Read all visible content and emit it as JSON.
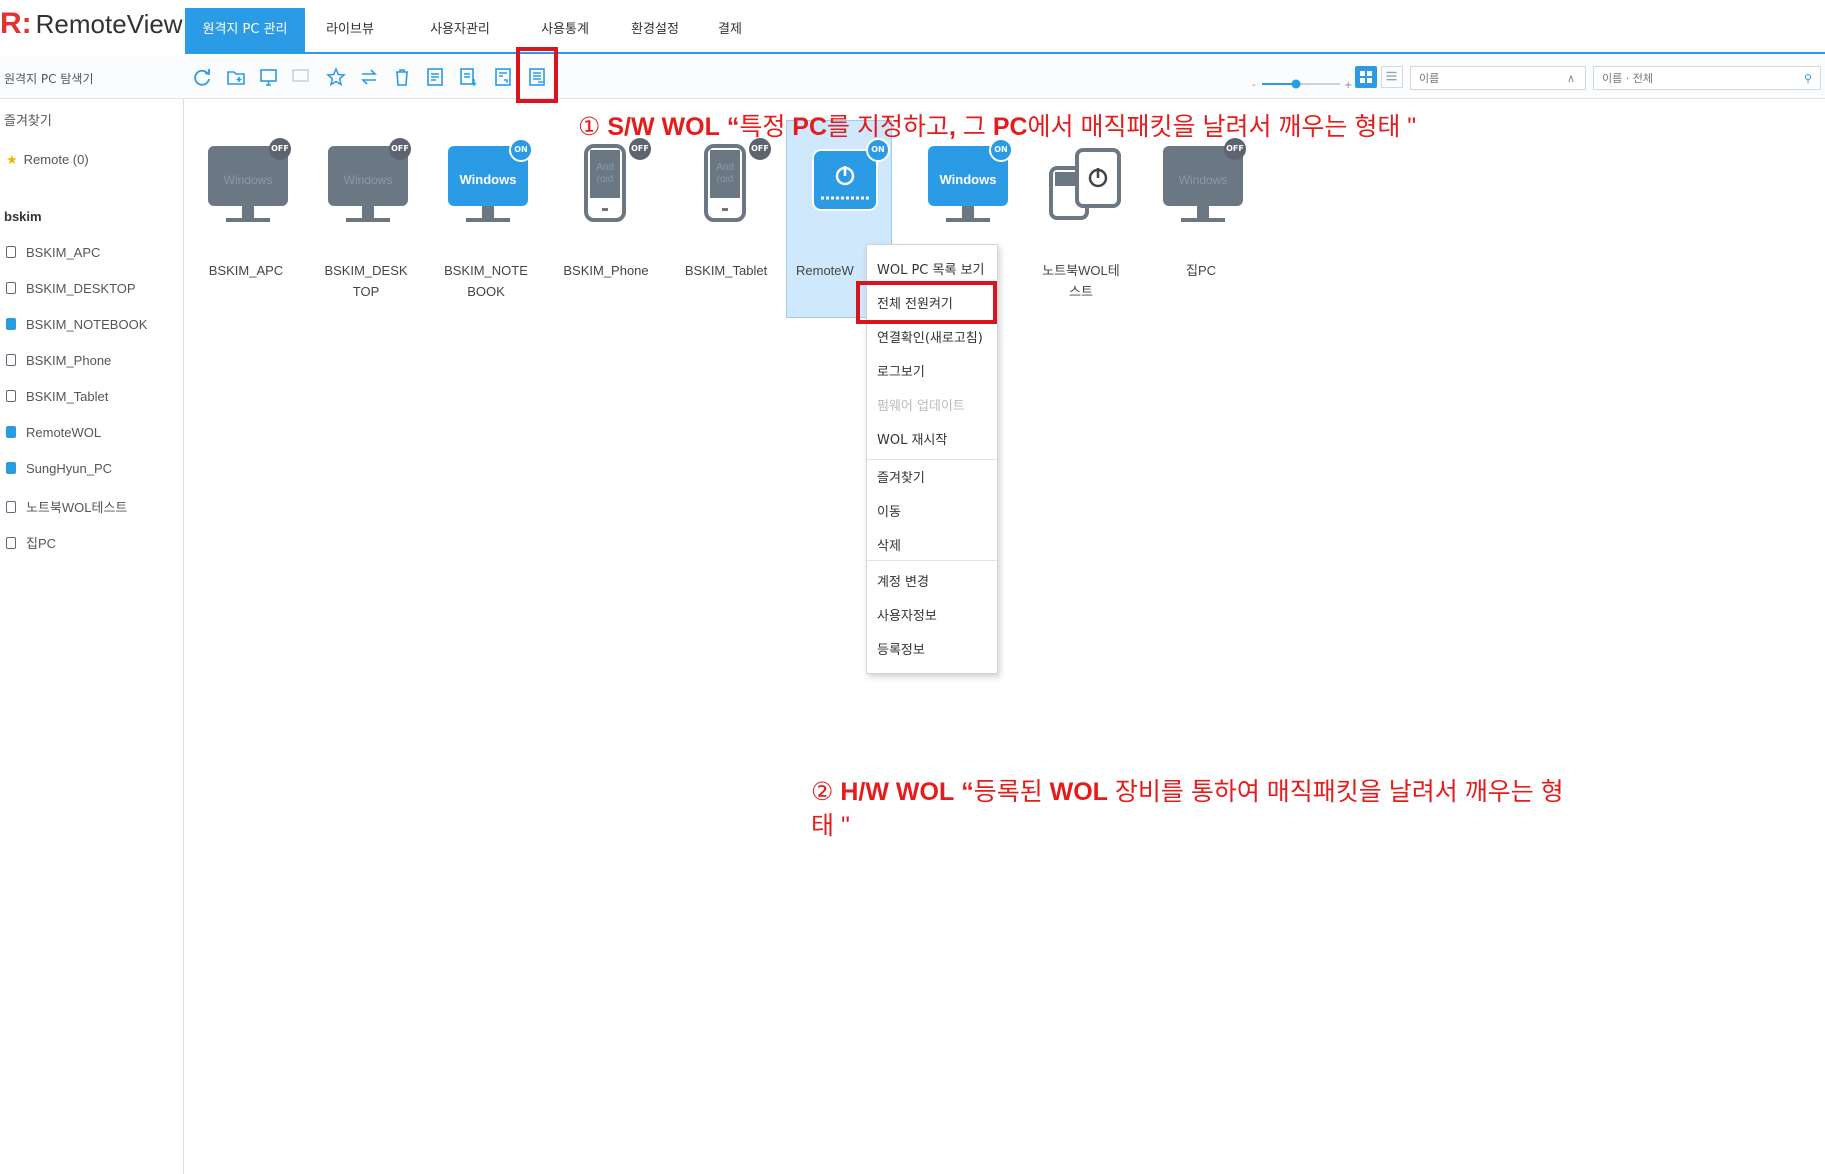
{
  "app": {
    "logo_mark": "R:",
    "logo_text": "RemoteView"
  },
  "nav_tabs": [
    "원격지 PC 관리",
    "라이브뷰",
    "사용자관리",
    "사용통계",
    "환경설정",
    "결제"
  ],
  "toolbar": {
    "explore_label": "원격지 PC 탐색기",
    "sort_label": "이름",
    "filter_label": "이름 · 전체"
  },
  "sidebar": {
    "favorites_header": "즐겨찾기",
    "favorites_item": "Remote (0)",
    "group_name": "bskim",
    "items": [
      "BSKIM_APC",
      "BSKIM_DESKTOP",
      "BSKIM_NOTEBOOK",
      "BSKIM_Phone",
      "BSKIM_Tablet",
      "RemoteWOL",
      "SungHyun_PC",
      "노트북WOL테스트",
      "집PC"
    ]
  },
  "devices": [
    {
      "label": "BSKIM_APC",
      "status": "OFF",
      "os": "Windows"
    },
    {
      "label": "BSKIM_DESKTOP",
      "status": "OFF",
      "os": "Windows"
    },
    {
      "label": "BSKIM_NOTEBOOK",
      "status": "ON",
      "os": "Windows"
    },
    {
      "label": "BSKIM_Phone",
      "status": "OFF",
      "os": "Android"
    },
    {
      "label": "BSKIM_Tablet",
      "status": "OFF",
      "os": "Android"
    },
    {
      "label": "RemoteW",
      "status": "ON",
      "os": "WOL"
    },
    {
      "label": "",
      "status": "ON",
      "os": "Windows"
    },
    {
      "label": "노트북WOL테스트",
      "status": "",
      "os": "WOL"
    },
    {
      "label": "집PC",
      "status": "OFF",
      "os": "Windows"
    }
  ],
  "device_os_text": {
    "windows": "Windows",
    "android_1": "And",
    "android_2": "roid"
  },
  "context_menu": {
    "items": [
      "WOL PC 목록 보기",
      "전체 전원켜기",
      "연결확인(새로고침)",
      "로그보기",
      "펌웨어 업데이트",
      "WOL 재시작",
      "즐겨찾기",
      "이동",
      "삭제",
      "계정 변경",
      "사용자정보",
      "등록정보"
    ]
  },
  "annotations": {
    "sw_num": "①",
    "sw_bold": "S/W WOL",
    "sw_q": "“",
    "sw_t1": "특정 ",
    "sw_b2": "PC",
    "sw_t2": "를 지정하고",
    "sw_b3": ",",
    "sw_t3": " 그 ",
    "sw_b4": "PC",
    "sw_t4": "에서 매직패킷을 날려서 깨우는 형태 \"",
    "hw_num": "②",
    "hw_bold": "H/W WOL",
    "hw_q": "“",
    "hw_t1": "등록된 ",
    "hw_b2": "WOL",
    "hw_t2": " 장비를 통하여 매직패킷을 날려서 깨우는 형",
    "hw_line2": "태 \""
  },
  "colors": {
    "accent": "#2b9be6",
    "highlight": "#d9141e",
    "annotation": "#e61c1c",
    "off_device": "#6c7784",
    "selected_bg": "#cfe8fb"
  }
}
